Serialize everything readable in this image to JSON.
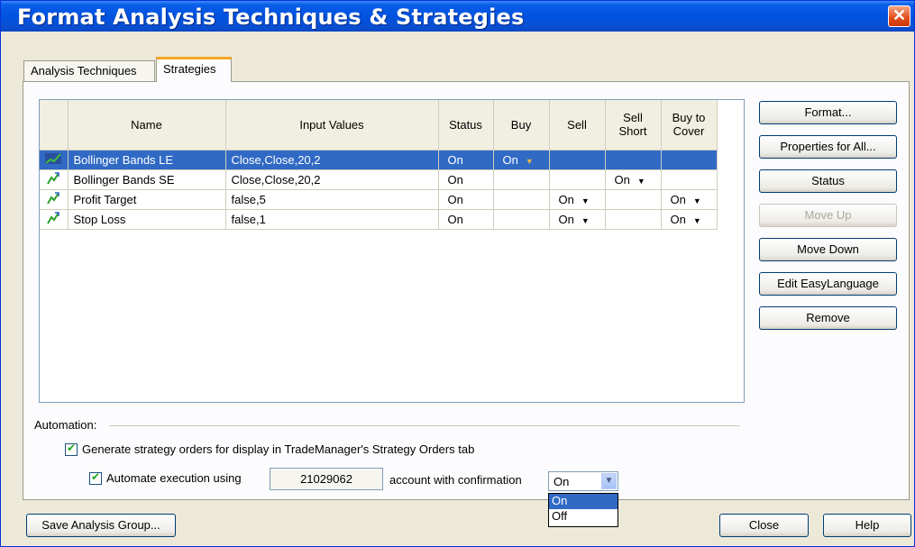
{
  "window": {
    "title": "Format Analysis Techniques & Strategies",
    "close_glyph": "✕"
  },
  "tabs": [
    {
      "label": "Analysis Techniques"
    },
    {
      "label": "Strategies"
    }
  ],
  "table": {
    "columns": [
      "Name",
      "Input Values",
      "Status",
      "Buy",
      "Sell",
      "Sell Short",
      "Buy to Cover"
    ],
    "rows": [
      {
        "name": "Bollinger Bands LE",
        "inputs": "Close,Close,20,2",
        "status": "On",
        "buy": "On",
        "sell": "",
        "sell_short": "",
        "buy_to_cover": "",
        "selected": true
      },
      {
        "name": "Bollinger Bands SE",
        "inputs": "Close,Close,20,2",
        "status": "On",
        "buy": "",
        "sell": "",
        "sell_short": "On",
        "buy_to_cover": ""
      },
      {
        "name": "Profit Target",
        "inputs": "false,5",
        "status": "On",
        "buy": "",
        "sell": "On",
        "sell_short": "",
        "buy_to_cover": "On"
      },
      {
        "name": "Stop Loss",
        "inputs": "false,1",
        "status": "On",
        "buy": "",
        "sell": "On",
        "sell_short": "",
        "buy_to_cover": "On"
      }
    ]
  },
  "side_buttons": {
    "format": "Format...",
    "properties_all": "Properties for All...",
    "status": "Status",
    "move_up": "Move Up",
    "move_down": "Move Down",
    "edit_easylanguage": "Edit EasyLanguage",
    "remove": "Remove"
  },
  "automation": {
    "label": "Automation:",
    "generate_orders": "Generate strategy orders for display in TradeManager's Strategy Orders tab",
    "automate_execution": "Automate execution using",
    "account": "21029062",
    "confirm_label": "account with confirmation",
    "confirm_value": "On",
    "confirm_options": [
      "On",
      "Off"
    ]
  },
  "bottom_buttons": {
    "save_group": "Save Analysis Group...",
    "close": "Close",
    "help": "Help"
  },
  "colors": {
    "title_bar": "#0053e0",
    "selection": "#316ac5",
    "active_tab": "#f5a623"
  }
}
